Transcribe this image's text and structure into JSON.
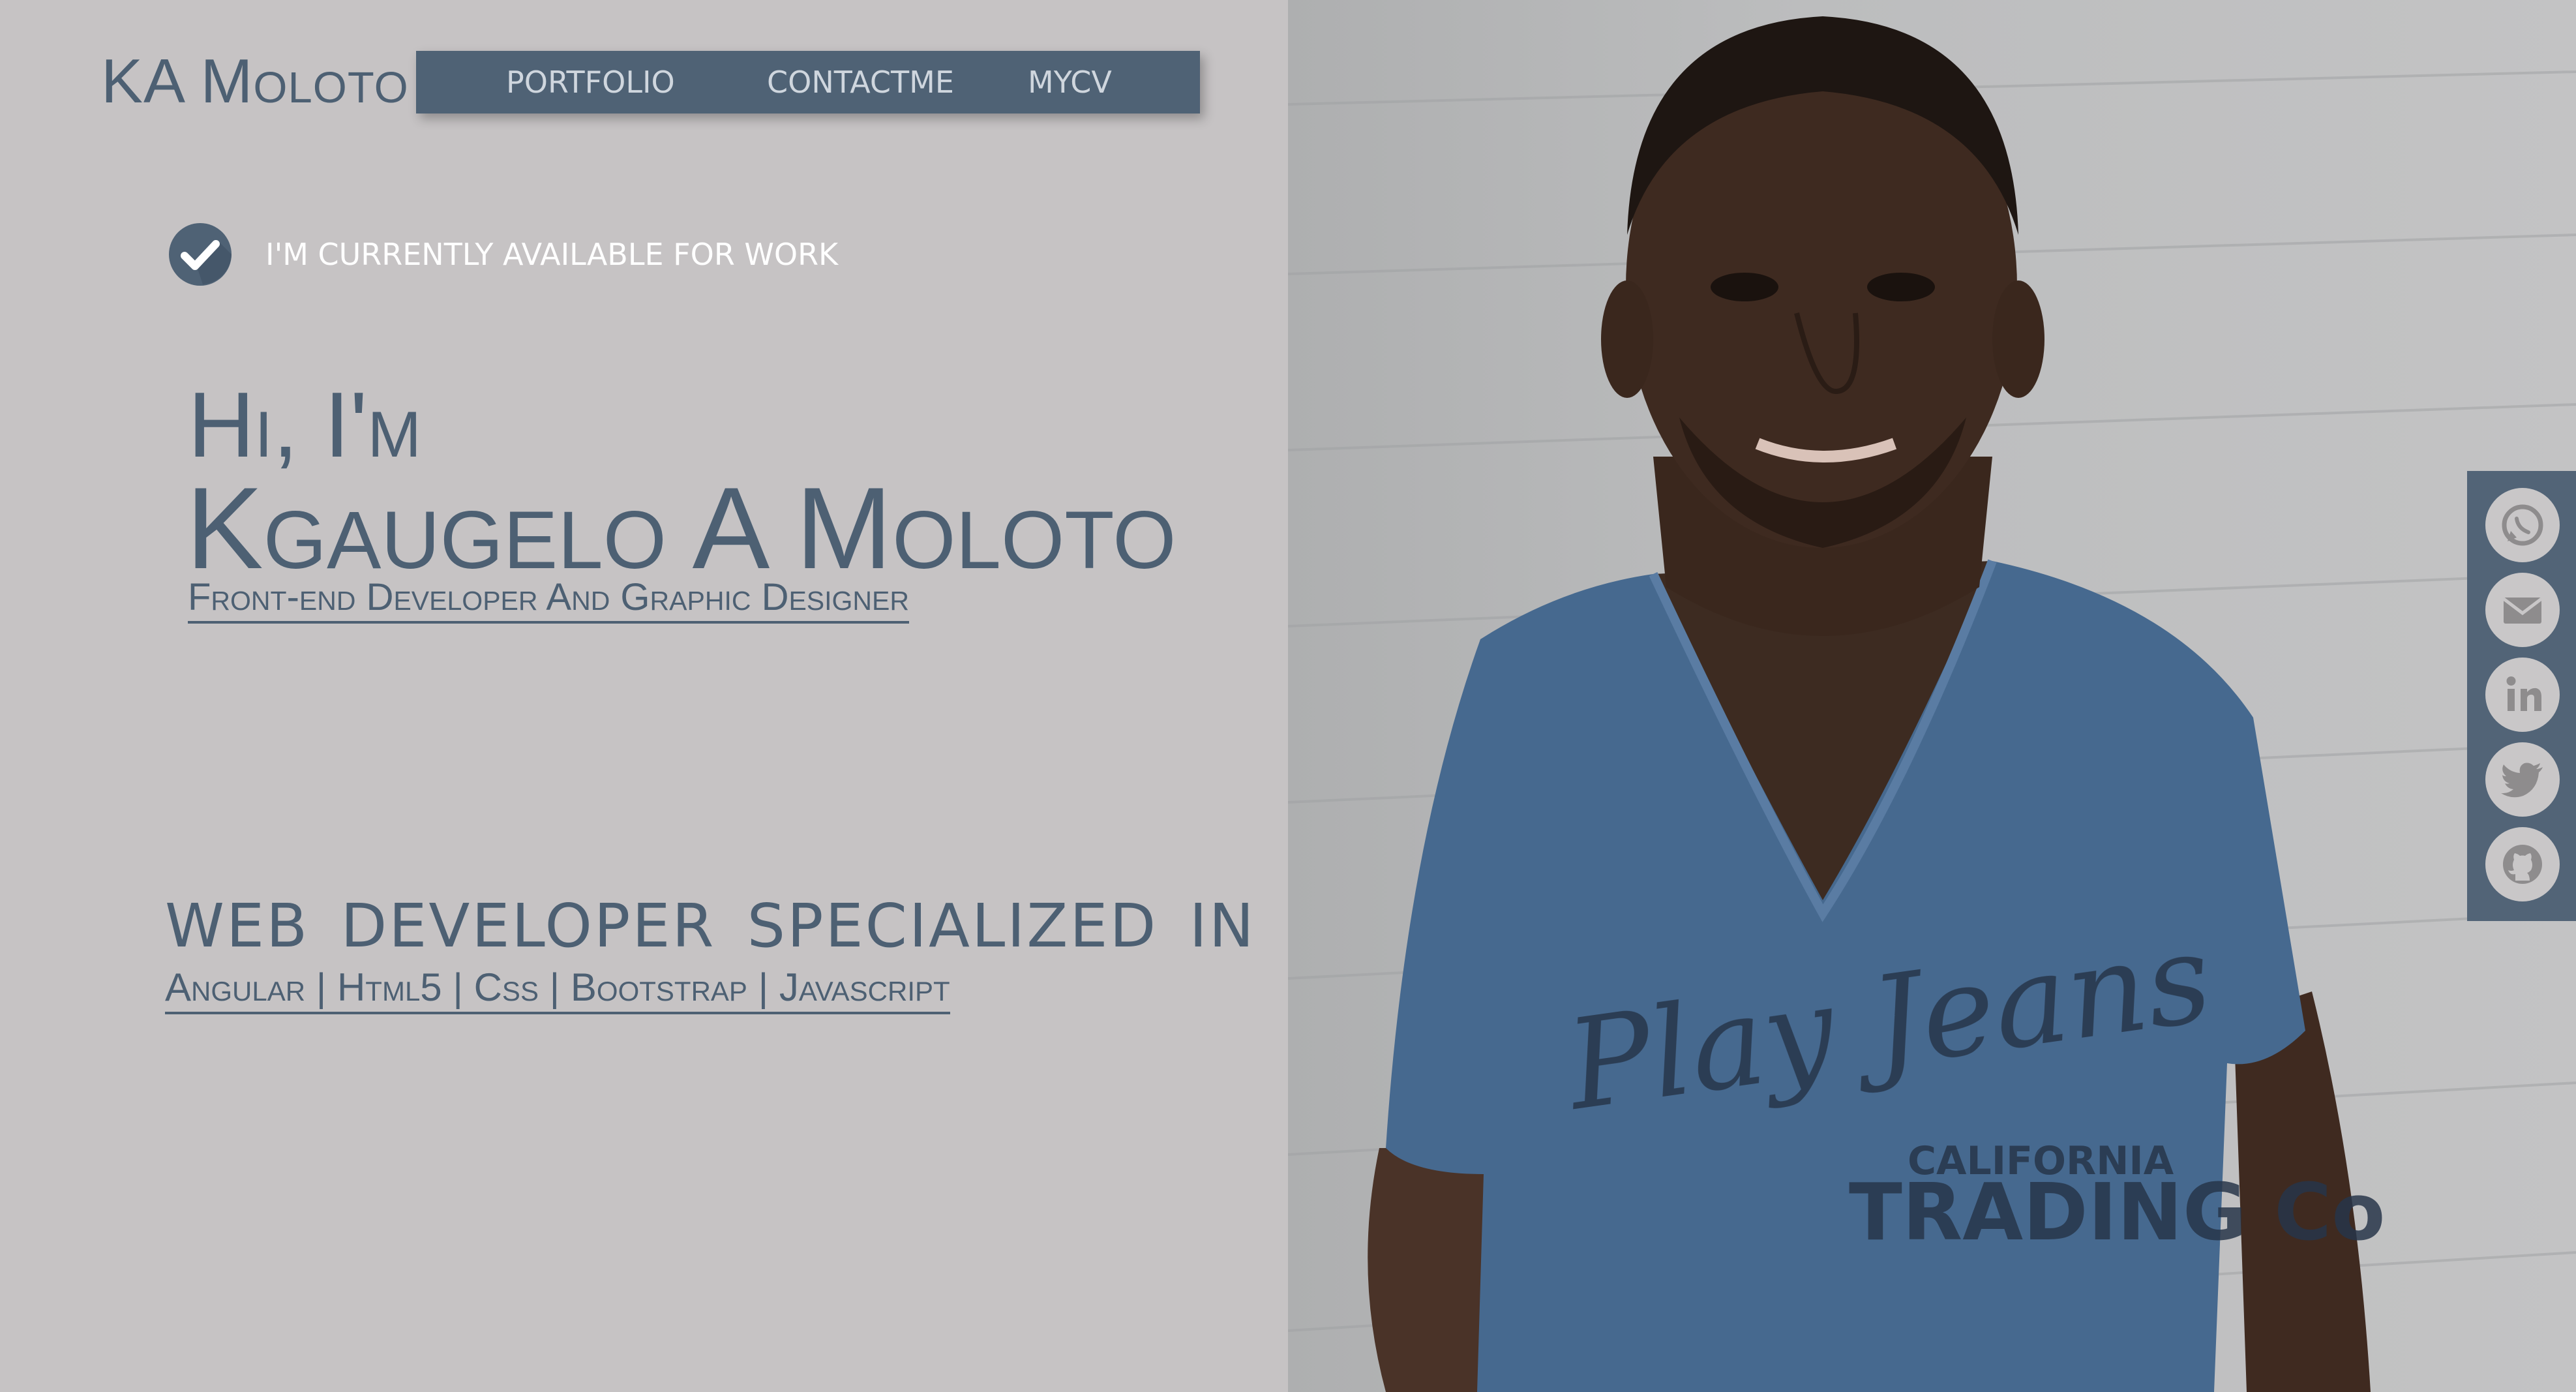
{
  "brand": {
    "name": "KA Moloto"
  },
  "nav": {
    "items": [
      {
        "label": "PORTFOLIO"
      },
      {
        "label": "CONTACTME"
      },
      {
        "label": "MYCV"
      }
    ]
  },
  "availability": {
    "text": "I'M CURRENTLY AVAILABLE FOR WORK",
    "icon": "check-circle-icon"
  },
  "hero": {
    "greeting": "Hi, I'm",
    "name": "Kgaugelo A Moloto",
    "role": "Front-end Developer And Graphic Designer"
  },
  "specialization": {
    "heading": "WEB DEVELOPER SPECIALIZED IN",
    "skills": "Angular | Html5 | Css | Bootstrap | Javascript"
  },
  "social": {
    "icons": [
      "whatsapp-icon",
      "mail-icon",
      "linkedin-icon",
      "twitter-icon",
      "github-icon"
    ]
  },
  "colors": {
    "background": "#c6c3c4",
    "accent": "#4f6275",
    "text": "#4d6073",
    "nav_text": "#cfd6de",
    "social_button": "#c9c7c8"
  }
}
